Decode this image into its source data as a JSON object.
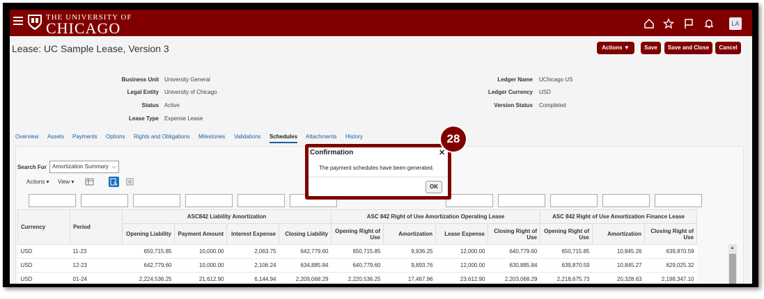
{
  "header": {
    "logo_top": "THE UNIVERSITY OF",
    "logo_bottom": "CHICAGO",
    "avatar_initials": "LA",
    "icons": [
      "home-icon",
      "favorites-star-icon",
      "notifications-flag-icon",
      "bell-icon"
    ]
  },
  "page": {
    "title": "Lease: UC Sample Lease, Version 3",
    "buttons": {
      "actions": "Actions",
      "save": "Save",
      "save_close": "Save and Close",
      "cancel": "Cancel"
    }
  },
  "details": {
    "left": [
      {
        "label": "Business Unit",
        "value": "University General"
      },
      {
        "label": "Legal Entity",
        "value": "University of Chicago"
      },
      {
        "label": "Status",
        "value": "Active"
      },
      {
        "label": "Lease Type",
        "value": "Expense Lease"
      }
    ],
    "right": [
      {
        "label": "Ledger Name",
        "value": "UChicago US"
      },
      {
        "label": "Ledger Currency",
        "value": "USD"
      },
      {
        "label": "Version Status",
        "value": "Completed"
      }
    ]
  },
  "tabs": [
    "Overview",
    "Assets",
    "Payments",
    "Options",
    "Rights and Obligations",
    "Milestones",
    "Validations",
    "Schedules",
    "Attachments",
    "History"
  ],
  "active_tab": "Schedules",
  "search": {
    "label": "Search For",
    "selected": "Amortization Summary"
  },
  "toolbar": {
    "actions": "Actions ▾",
    "view": "View ▾"
  },
  "table": {
    "group_headers": [
      "ASC842 Liability Amortization",
      "ASC 842 Right of Use Amortization Operating Lease",
      "ASC 842 Right of Use Amortization Finance Lease"
    ],
    "col_currency": "Currency",
    "col_period": "Period",
    "columns": [
      "Opening Liability",
      "Payment Amount",
      "Interest Expense",
      "Closing Liability",
      "Opening Right of Use",
      "Amortization",
      "Lease Expense",
      "Closing Right of Use",
      "Opening Right of Use",
      "Amortization",
      "Closing Right of Use"
    ],
    "rows": [
      [
        "USD",
        "11-23",
        "650,715.85",
        "10,000.00",
        "2,063.75",
        "642,779.60",
        "650,715.85",
        "9,936.25",
        "12,000.00",
        "640,779.60",
        "650,715.85",
        "10,845.26",
        "639,870.59"
      ],
      [
        "USD",
        "12-23",
        "642,779.60",
        "10,000.00",
        "2,106.24",
        "634,885.84",
        "640,779.60",
        "9,893.76",
        "12,000.00",
        "630,885.84",
        "639,870.59",
        "10,845.27",
        "629,025.32"
      ],
      [
        "USD",
        "01-24",
        "2,224,536.25",
        "21,612.90",
        "6,144.94",
        "2,209,068.29",
        "2,220,536.25",
        "17,467.96",
        "23,612.90",
        "2,203,068.29",
        "2,218,675.73",
        "20,328.63",
        "2,198,347.10"
      ]
    ]
  },
  "dialog": {
    "title": "Confirmation",
    "message": "The payment schedules have been generated.",
    "ok": "OK",
    "close": "✕"
  },
  "step_badge": "28"
}
